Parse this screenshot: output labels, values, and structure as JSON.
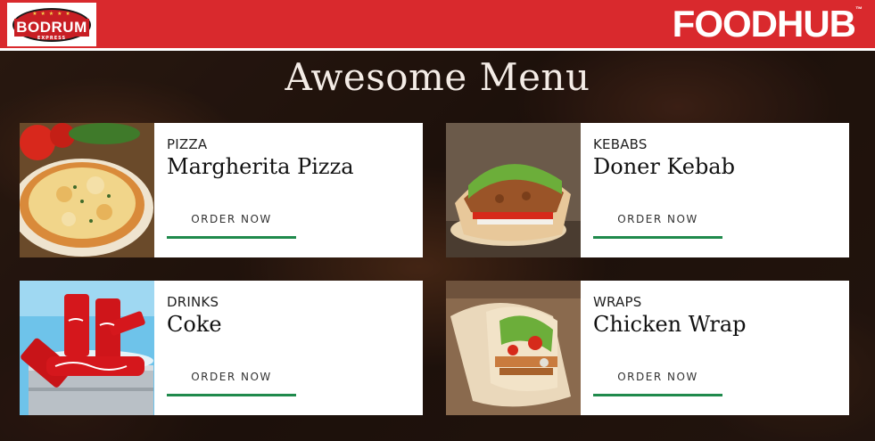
{
  "header": {
    "brand_name": "BODRUM",
    "brand_sub": "EXPRESS",
    "brand_stars": "★ ★ ★ ★ ★",
    "foodhub_label": "FOODHUB",
    "trademark": "™"
  },
  "page": {
    "title": "Awesome Menu"
  },
  "menu": {
    "items": [
      {
        "category": "PIZZA",
        "name": "Margherita Pizza",
        "button": "ORDER NOW",
        "image_icon": "pizza-image"
      },
      {
        "category": "KEBABS",
        "name": "Doner Kebab",
        "button": "ORDER NOW",
        "image_icon": "kebab-image"
      },
      {
        "category": "DRINKS",
        "name": "Coke",
        "button": "ORDER NOW",
        "image_icon": "coke-image"
      },
      {
        "category": "WRAPS",
        "name": "Chicken Wrap",
        "button": "ORDER NOW",
        "image_icon": "wrap-image"
      }
    ]
  },
  "colors": {
    "header_red": "#d9292d",
    "button_underline": "#1f8a4c",
    "title_color": "#f4ece6"
  }
}
